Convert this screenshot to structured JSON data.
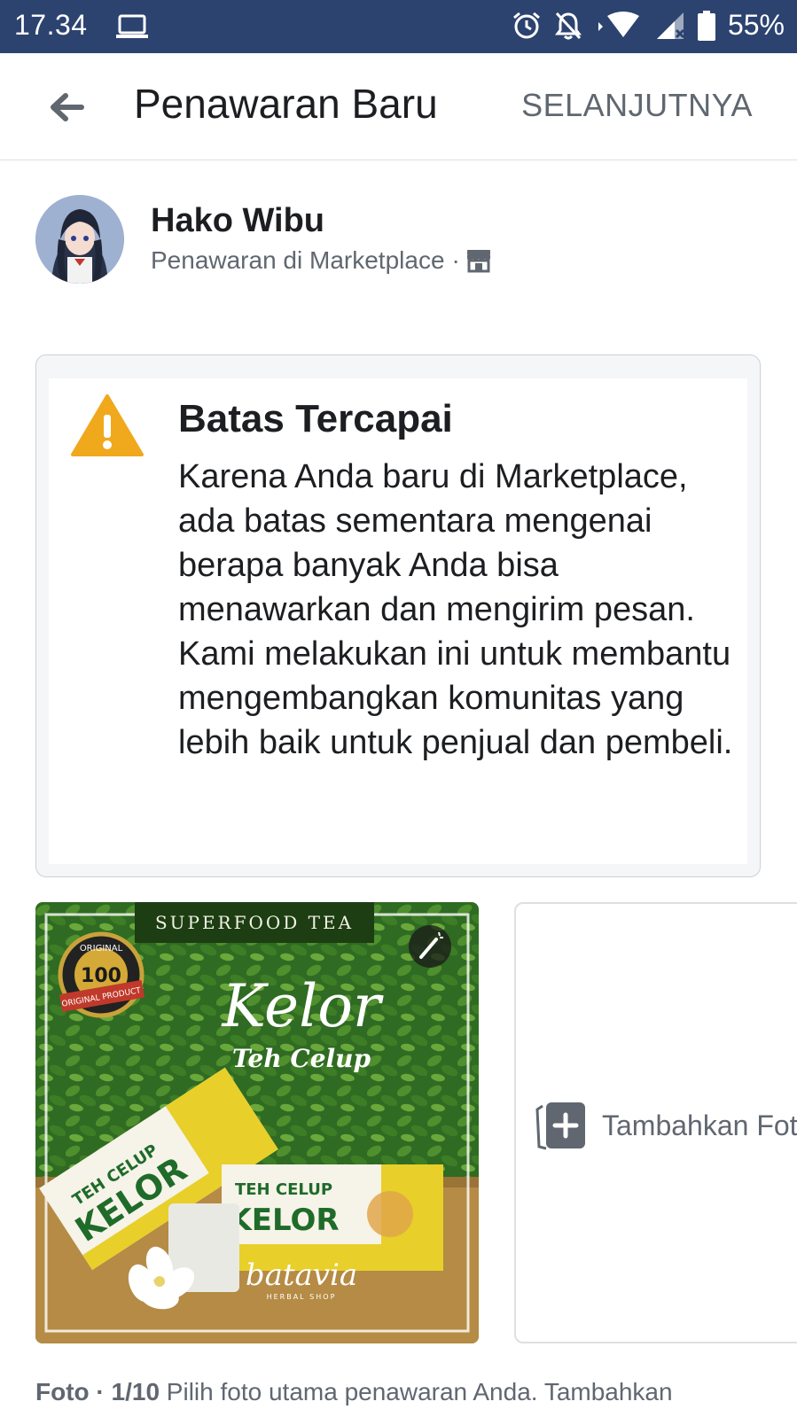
{
  "status_bar": {
    "time": "17.34",
    "battery": "55%"
  },
  "header": {
    "title": "Penawaran Baru",
    "next_label": "SELANJUTNYA"
  },
  "profile": {
    "name": "Hako Wibu",
    "subtitle": "Penawaran di Marketplace",
    "separator": "·"
  },
  "warning": {
    "title": "Batas Tercapai",
    "body": "Karena Anda baru di Marketplace, ada batas sementara mengenai berapa banyak Anda bisa menawarkan dan mengirim pesan. Kami melakukan ini untuk membantu mengembangkan komunitas yang lebih baik untuk penjual dan pembeli."
  },
  "photo": {
    "banner": "SUPERFOOD TEA",
    "badge_number": "100",
    "badge_top": "ORIGINAL",
    "badge_ribbon": "ORIGINAL PRODUCT",
    "script_title": "Kelor",
    "subtitle": "Teh Celup",
    "box_line1": "TEH CELUP",
    "box_line2": "KELOR",
    "brand": "batavia",
    "brand_sub": "HERBAL SHOP"
  },
  "add_photo": {
    "label": "Tambahkan Foto"
  },
  "photo_help": {
    "label": "Foto",
    "separator": " · ",
    "count": "1/10",
    "text": " Pilih foto utama penawaran Anda. Tambahkan"
  },
  "colors": {
    "status_bar": "#2c4370",
    "warning_icon": "#f0a81c",
    "muted_text": "#606770"
  }
}
